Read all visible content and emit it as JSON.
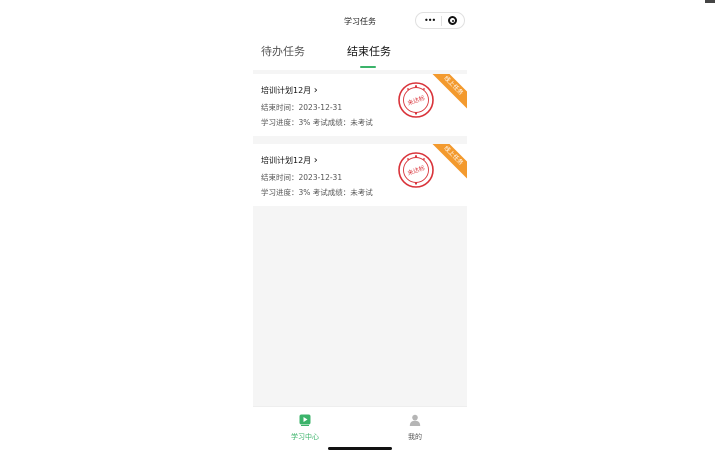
{
  "header": {
    "title": "学习任务",
    "dots_glyph": "•••"
  },
  "tabs": [
    {
      "label": "待办任务",
      "active": false
    },
    {
      "label": "结束任务",
      "active": true
    }
  ],
  "cards": [
    {
      "title": "培训计划12月",
      "end_time": "结束时间：2023-12-31",
      "progress": "学习进度：3% 考试成绩：未考试",
      "stamp_text": "未达标",
      "ribbon": "线上任务"
    },
    {
      "title": "培训计划12月",
      "end_time": "结束时间：2023-12-31",
      "progress": "学习进度：3% 考试成绩：未考试",
      "stamp_text": "未达标",
      "ribbon": "线上任务"
    }
  ],
  "chevron": "›",
  "bottom_nav": [
    {
      "label": "学习中心",
      "icon": "play-icon",
      "active": true
    },
    {
      "label": "我的",
      "icon": "user-icon",
      "active": false
    }
  ],
  "colors": {
    "accent": "#3bb36a",
    "ribbon": "#f39a2e",
    "stamp": "#d9333a"
  }
}
